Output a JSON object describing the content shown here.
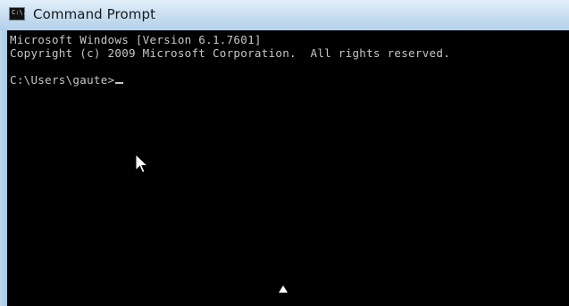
{
  "window": {
    "title": "Command Prompt",
    "icon": "cmd-icon",
    "icon_label": "C:\\."
  },
  "console": {
    "line1": "Microsoft Windows [Version 6.1.7601]",
    "line2": "Copyright (c) 2009 Microsoft Corporation.  All rights reserved.",
    "prompt": "C:\\Users\\gaute>"
  },
  "colors": {
    "console_background": "#000000",
    "console_text": "#c7c7c7",
    "titlebar": "#c6ddf0"
  }
}
